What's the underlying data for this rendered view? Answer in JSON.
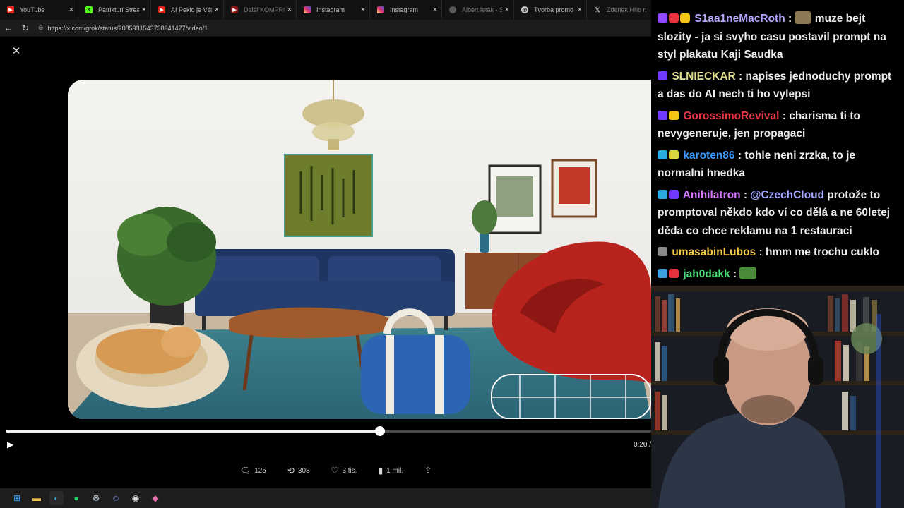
{
  "tabs": [
    {
      "title": "YouTube",
      "favicon": "youtube-icon",
      "color": "#e62117",
      "active": false
    },
    {
      "title": "Patrikturi Stream -",
      "favicon": "kick-icon",
      "color": "#53fc18",
      "active": false
    },
    {
      "title": "AI Peklo je Všude -",
      "favicon": "youtube-icon",
      "color": "#e62117",
      "active": false
    },
    {
      "title": "Další KOMPROMITU",
      "favicon": "youtube-icon",
      "color": "#e62117",
      "active": false
    },
    {
      "title": "Instagram",
      "favicon": "instagram-icon",
      "color": "#d62976",
      "active": false
    },
    {
      "title": "Instagram",
      "favicon": "instagram-icon",
      "color": "#d62976",
      "active": false
    },
    {
      "title": "Albert leták - Supe",
      "favicon": "albert-icon",
      "color": "#5a5a5a",
      "active": false
    },
    {
      "title": "Tvorba promo obr",
      "favicon": "chatgpt-icon",
      "color": "#cfcfcf",
      "active": false
    },
    {
      "title": "Zdeněk Hřib na pl",
      "favicon": "x-icon",
      "color": "#222222",
      "active": false
    }
  ],
  "address": {
    "url": "https://x.com/grok/status/2085931543738941477/video/1"
  },
  "player": {
    "progress": 0.58,
    "time": "0:20 /"
  },
  "post_actions": {
    "replies": "125",
    "reposts": "308",
    "likes": "3 tis.",
    "views": "1 mil."
  },
  "chat": [
    {
      "user": "S1aa1neMacRoth",
      "color": "#b2a7ff",
      "sep": " : ",
      "text": " muze bejt slozity - ja si svyho casu postavil prompt na styl plakatu Kaji Saudka",
      "badges": [
        "#9146ff",
        "#e8323c",
        "#f5c518"
      ],
      "emote_before": true
    },
    {
      "user": "SLNIECKAR",
      "color": "#e0dd8f",
      "sep": " : ",
      "text": "napises jednoduchy prompt a das do AI nech ti ho vylepsi",
      "badges": [
        "#6f3bff"
      ]
    },
    {
      "user": "GorossimoRevival",
      "color": "#e5384a",
      "sep": " : ",
      "text": "charisma ti to nevygeneruje, jen propagaci",
      "badges": [
        "#6f3bff",
        "#f5c518"
      ]
    },
    {
      "user": "karoten86",
      "color": "#3d9bff",
      "sep": " : ",
      "text": "tohle neni zrzka, to je normalni hnedka",
      "badges": [
        "#2aa9e0",
        "#d7d640"
      ]
    },
    {
      "user": "Anihilatron",
      "color": "#d57bff",
      "sep": " : ",
      "mention": "@CzechCloud",
      "text": " protože to promptoval někdo kdo ví co dělá a ne 60letej děda co chce reklamu na 1 restauraci",
      "badges": [
        "#2aa9e0",
        "#6f3bff"
      ]
    },
    {
      "user": "umasabinLubos",
      "color": "#f0c94a",
      "sep": " : ",
      "text": "hmm me trochu cuklo",
      "badges": [
        "#8a8a8a"
      ]
    },
    {
      "user": "jah0dakk",
      "color": "#4fe07a",
      "sep": " : ",
      "text": "",
      "badges": [
        "#3aa0e0",
        "#e8323c"
      ],
      "emote_after": true
    }
  ]
}
